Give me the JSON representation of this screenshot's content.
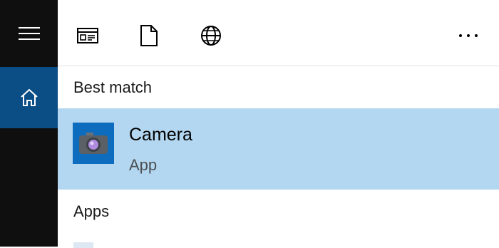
{
  "rail": {
    "menu_icon": "hamburger-menu-icon",
    "home_icon": "home-icon",
    "accent": "#0b4d85",
    "background": "#0f0f0f"
  },
  "toolbar": {
    "icons": [
      "apps-filter-icon",
      "documents-filter-icon",
      "web-filter-icon",
      "more-options-icon"
    ]
  },
  "results": {
    "best_match_header": "Best match",
    "best_match": {
      "title": "Camera",
      "subtitle": "App",
      "icon": "camera-app-icon",
      "highlight_color": "#b4d7f1",
      "icon_tile_color": "#0e6cbf"
    },
    "apps_header": "Apps"
  }
}
